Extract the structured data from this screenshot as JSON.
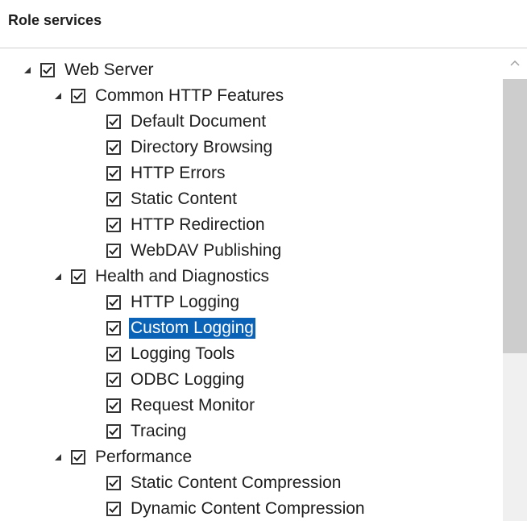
{
  "header": {
    "title": "Role services"
  },
  "tree": {
    "items": [
      {
        "label": "Web Server",
        "level": 0,
        "expandable": true,
        "checked": true,
        "selected": false
      },
      {
        "label": "Common HTTP Features",
        "level": 1,
        "expandable": true,
        "checked": true,
        "selected": false
      },
      {
        "label": "Default Document",
        "level": 2,
        "expandable": false,
        "checked": true,
        "selected": false
      },
      {
        "label": "Directory Browsing",
        "level": 2,
        "expandable": false,
        "checked": true,
        "selected": false
      },
      {
        "label": "HTTP Errors",
        "level": 2,
        "expandable": false,
        "checked": true,
        "selected": false
      },
      {
        "label": "Static Content",
        "level": 2,
        "expandable": false,
        "checked": true,
        "selected": false
      },
      {
        "label": "HTTP Redirection",
        "level": 2,
        "expandable": false,
        "checked": true,
        "selected": false
      },
      {
        "label": "WebDAV Publishing",
        "level": 2,
        "expandable": false,
        "checked": true,
        "selected": false
      },
      {
        "label": "Health and Diagnostics",
        "level": 1,
        "expandable": true,
        "checked": true,
        "selected": false
      },
      {
        "label": "HTTP Logging",
        "level": 2,
        "expandable": false,
        "checked": true,
        "selected": false
      },
      {
        "label": "Custom Logging",
        "level": 2,
        "expandable": false,
        "checked": true,
        "selected": true
      },
      {
        "label": "Logging Tools",
        "level": 2,
        "expandable": false,
        "checked": true,
        "selected": false
      },
      {
        "label": "ODBC Logging",
        "level": 2,
        "expandable": false,
        "checked": true,
        "selected": false
      },
      {
        "label": "Request Monitor",
        "level": 2,
        "expandable": false,
        "checked": true,
        "selected": false
      },
      {
        "label": "Tracing",
        "level": 2,
        "expandable": false,
        "checked": true,
        "selected": false
      },
      {
        "label": "Performance",
        "level": 1,
        "expandable": true,
        "checked": true,
        "selected": false
      },
      {
        "label": "Static Content Compression",
        "level": 2,
        "expandable": false,
        "checked": true,
        "selected": false
      },
      {
        "label": "Dynamic Content Compression",
        "level": 2,
        "expandable": false,
        "checked": true,
        "selected": false
      }
    ]
  },
  "icons": {
    "expander": "expanded-triangle-icon",
    "checkbox": "checkmark-icon",
    "scroll_up": "chevron-up-icon"
  },
  "colors": {
    "selection": "#0b63b8",
    "scroll_thumb": "#cdcdcd"
  }
}
